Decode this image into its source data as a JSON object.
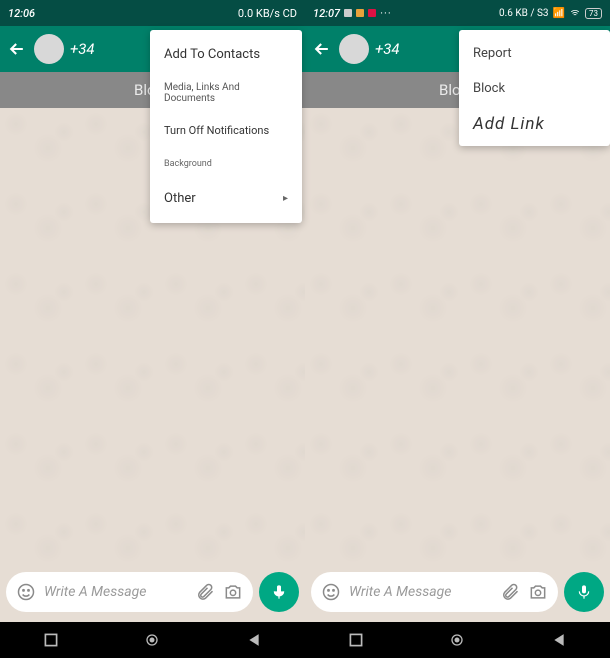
{
  "left": {
    "status": {
      "time": "12:06",
      "net": "0.0 KB/s CD"
    },
    "contact": "+34",
    "banner": "Block",
    "menu": {
      "add_contacts": "Add To Contacts",
      "media": "Media, Links And Documents",
      "mute": "Turn Off Notifications",
      "background": "Background",
      "other": "Other"
    },
    "input_placeholder": "Write A Message"
  },
  "right": {
    "status": {
      "time": "12:07",
      "net": "0.6 KB / S3",
      "battery": "73"
    },
    "contact": "+34",
    "banner": "Block",
    "menu": {
      "report": "Report",
      "block": "Block",
      "add_link": "Add Link"
    },
    "input_placeholder": "Write A Message"
  }
}
